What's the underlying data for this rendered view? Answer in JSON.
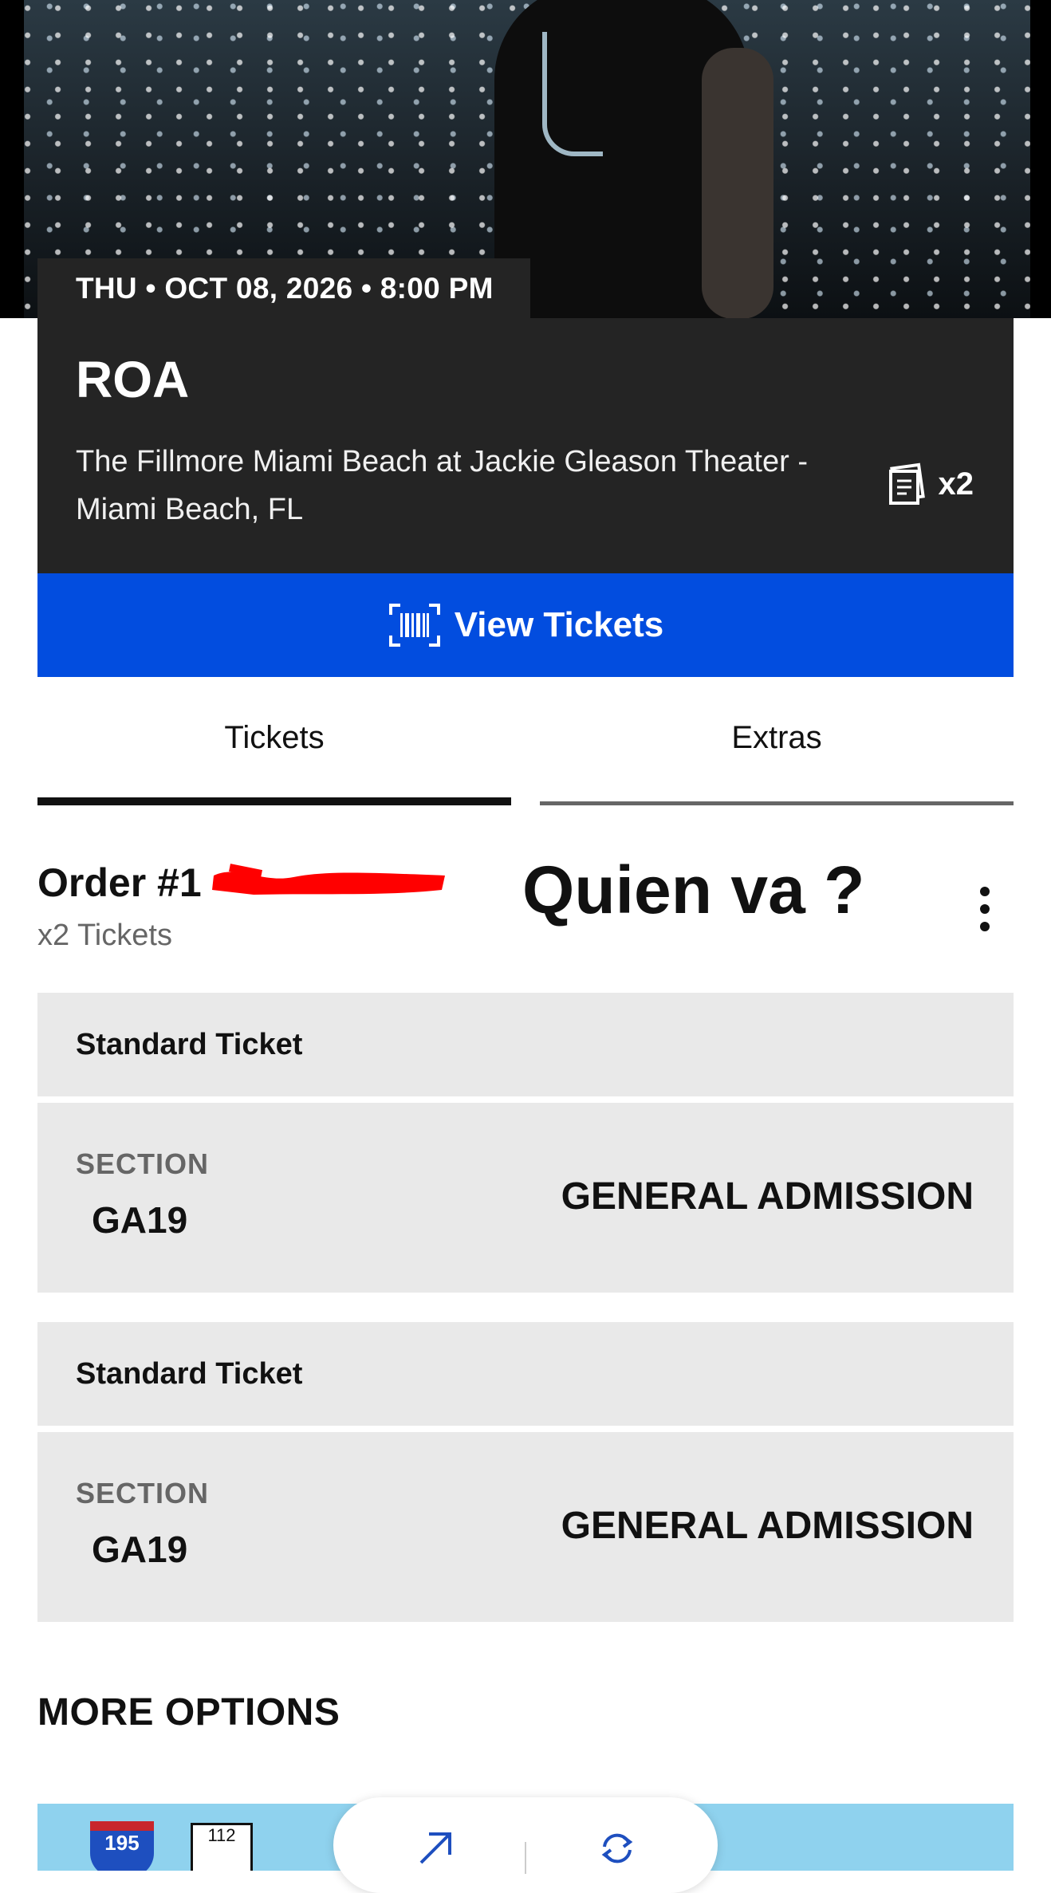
{
  "event": {
    "datetime": "THU • OCT 08, 2026 • 8:00 PM",
    "title": "ROA",
    "venue": "The Fillmore Miami Beach at Jackie Gleason Theater - Miami Beach, FL",
    "ticket_count": "x2"
  },
  "actions": {
    "view_tickets": "View Tickets"
  },
  "tabs": [
    {
      "label": "Tickets",
      "active": true
    },
    {
      "label": "Extras",
      "active": false
    }
  ],
  "order": {
    "title": "Order #1",
    "subtitle": "x2 Tickets",
    "overlay_text": "Quien va ?"
  },
  "tickets": [
    {
      "type": "Standard Ticket",
      "section_label": "SECTION",
      "section": "GA19",
      "admission": "GENERAL ADMISSION"
    },
    {
      "type": "Standard Ticket",
      "section_label": "SECTION",
      "section": "GA19",
      "admission": "GENERAL ADMISSION"
    }
  ],
  "more_options": {
    "heading": "MORE OPTIONS"
  },
  "map_banner": {
    "shield_number": "195",
    "route_number": "112"
  },
  "colors": {
    "accent": "#024ddf",
    "card_dark": "#242424",
    "ticket_bg": "#e9e9e9",
    "redaction": "#ff0000"
  },
  "icons": [
    "ticket-stack-icon",
    "barcode-icon",
    "kebab-menu-icon",
    "share-arrow-icon",
    "refresh-icon"
  ]
}
